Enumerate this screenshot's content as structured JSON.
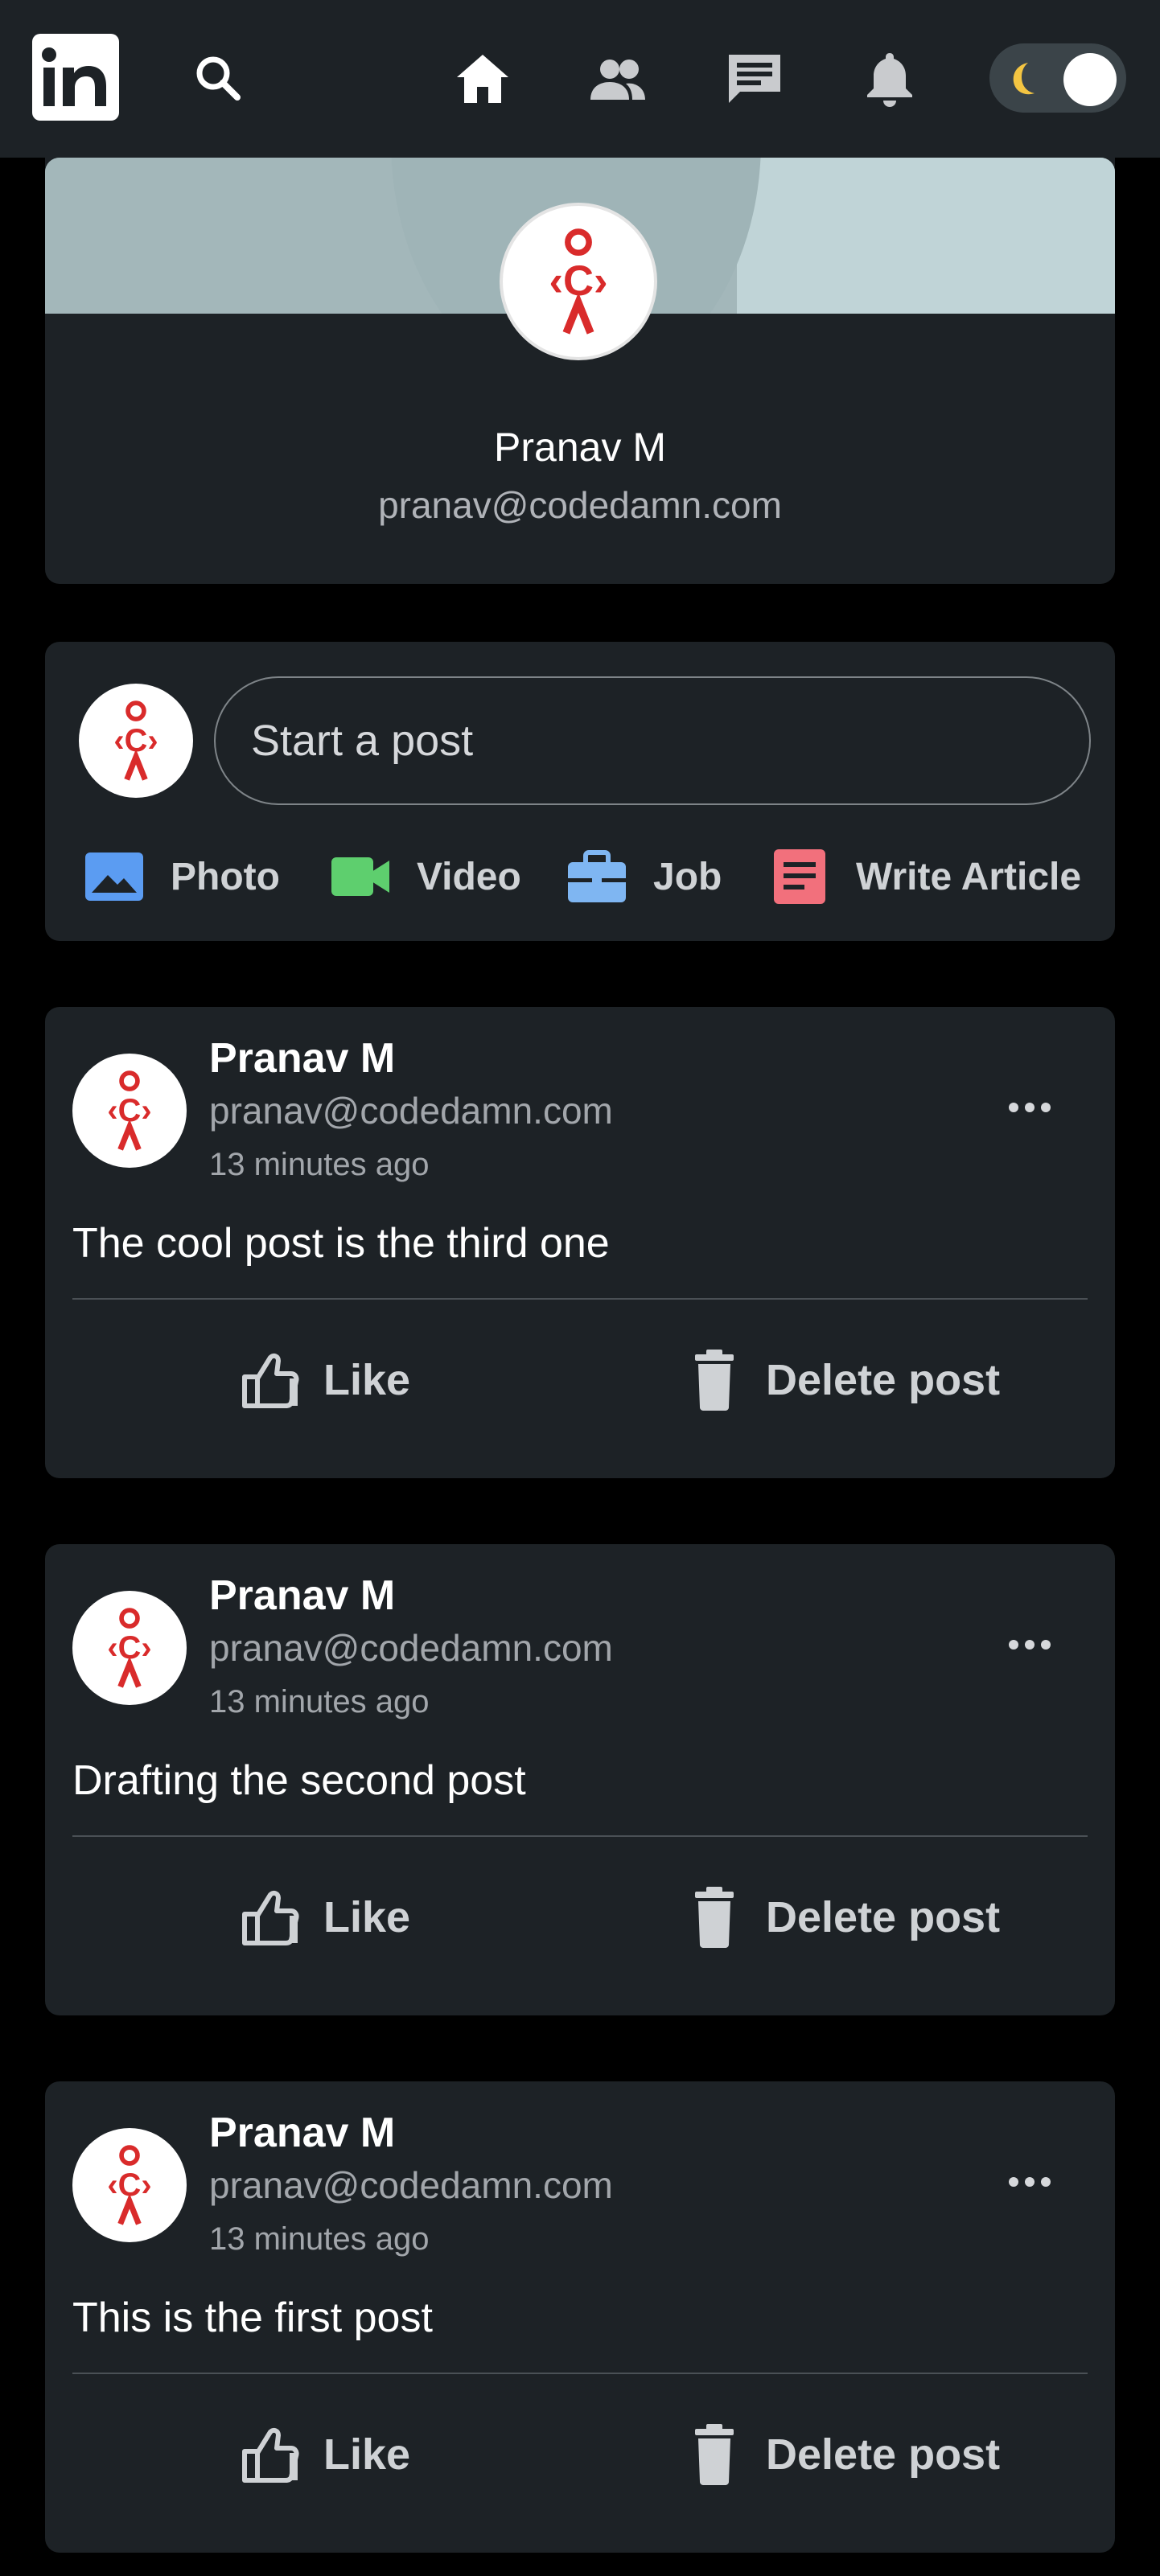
{
  "navbar": {
    "logo_text": "in",
    "icons": [
      "linkedin-logo",
      "search-icon",
      "home-icon",
      "people-icon",
      "messages-icon",
      "bell-icon"
    ],
    "theme_toggle": "dark-mode"
  },
  "profile": {
    "name": "Pranav M",
    "email": "pranav@codedamn.com"
  },
  "start_post": {
    "placeholder": "Start a post",
    "actions": [
      {
        "label": "Photo",
        "icon": "photo-icon",
        "color": "#5b9cf2"
      },
      {
        "label": "Video",
        "icon": "video-icon",
        "color": "#5ecf6e"
      },
      {
        "label": "Job",
        "icon": "briefcase-icon",
        "color": "#7fb6f2"
      },
      {
        "label": "Write Article",
        "icon": "article-icon",
        "color": "#f2707c"
      }
    ]
  },
  "posts": [
    {
      "author": "Pranav M",
      "email": "pranav@codedamn.com",
      "time": "13 minutes ago",
      "text": "The cool post is the third one",
      "like_label": "Like",
      "delete_label": "Delete post"
    },
    {
      "author": "Pranav M",
      "email": "pranav@codedamn.com",
      "time": "13 minutes ago",
      "text": "Drafting the second post",
      "like_label": "Like",
      "delete_label": "Delete post"
    },
    {
      "author": "Pranav M",
      "email": "pranav@codedamn.com",
      "time": "13 minutes ago",
      "text": "This is the first post",
      "like_label": "Like",
      "delete_label": "Delete post"
    }
  ],
  "colors": {
    "background": "#000000",
    "surface": "#1d2226",
    "text_primary": "#ffffff",
    "text_secondary": "#b0b3b8",
    "avatar_brand": "#d92b2b"
  }
}
